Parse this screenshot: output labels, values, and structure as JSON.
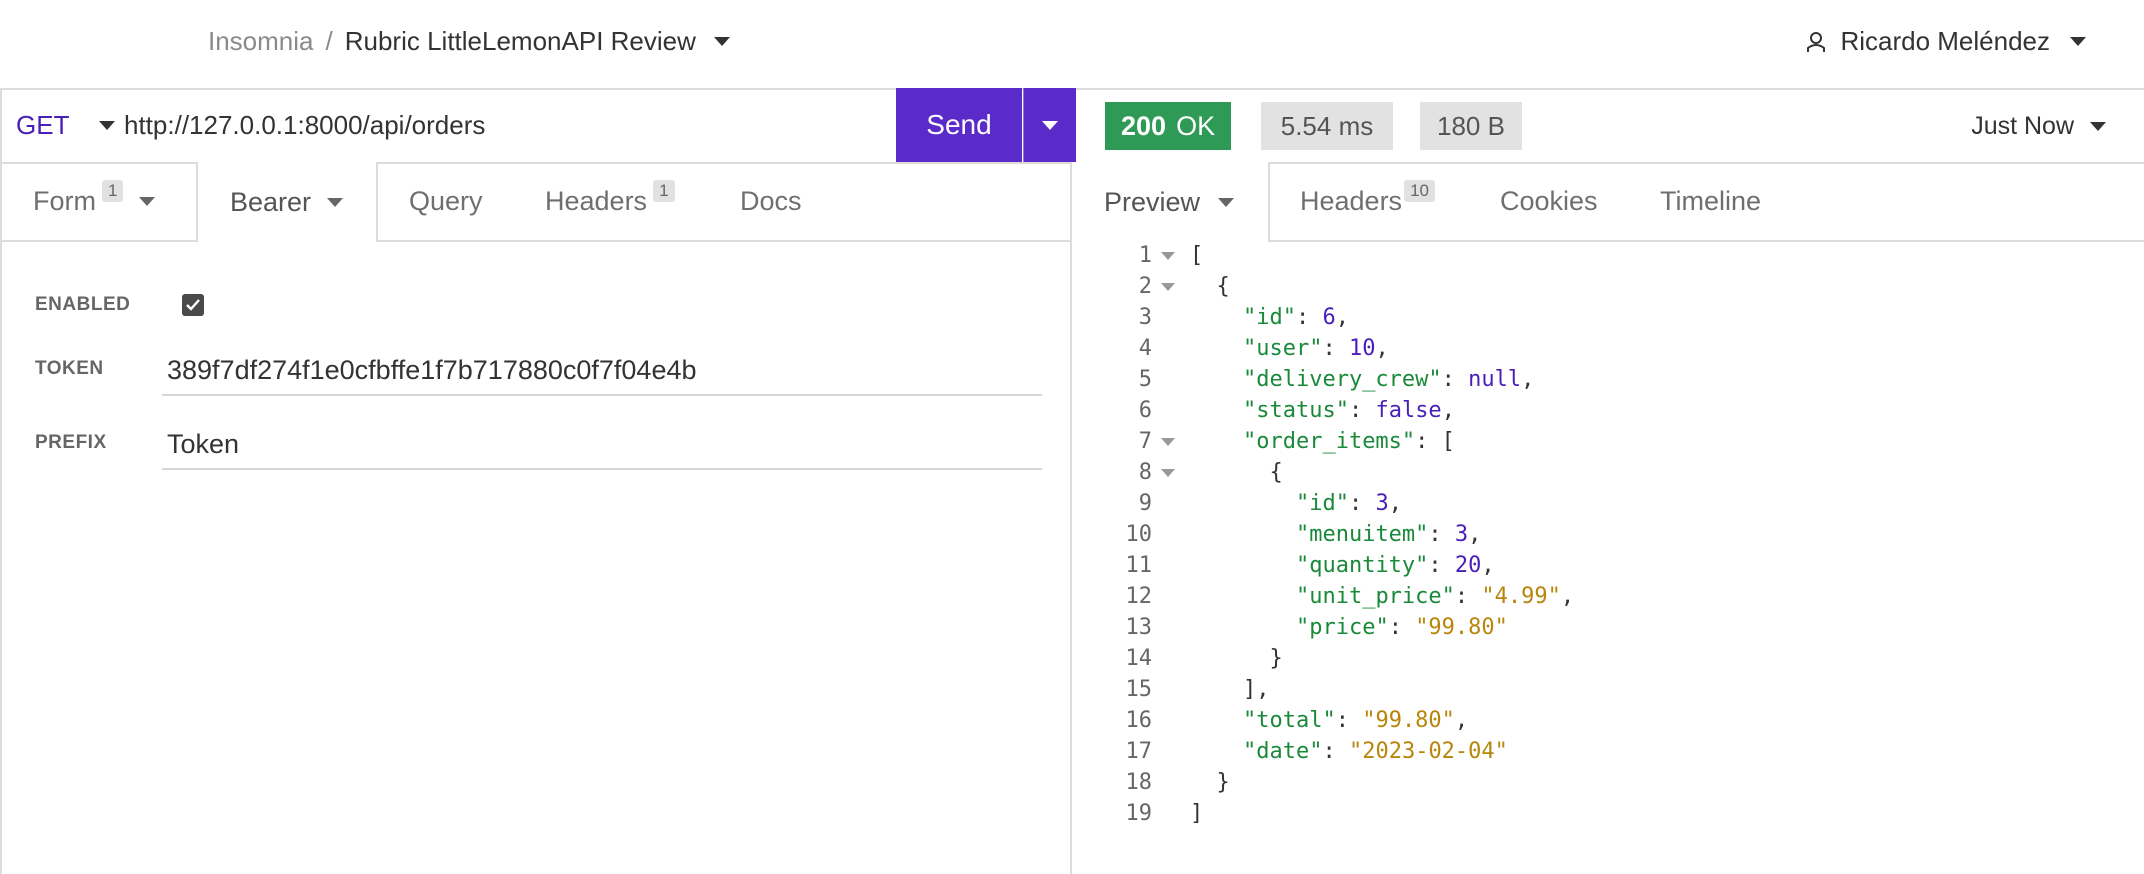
{
  "header": {
    "breadcrumb_home": "Insomnia",
    "breadcrumb_sep": "/",
    "breadcrumb_current": "Rubric LittleLemonAPI Review",
    "user_name": "Ricardo Meléndez"
  },
  "request": {
    "method": "GET",
    "url": "http://127.0.0.1:8000/api/orders",
    "send_label": "Send",
    "tabs": [
      {
        "label": "Form",
        "badge": "1",
        "has_caret": true
      },
      {
        "label": "Bearer",
        "badge": "",
        "has_caret": true,
        "active": true
      },
      {
        "label": "Query",
        "badge": ""
      },
      {
        "label": "Headers",
        "badge": "1"
      },
      {
        "label": "Docs",
        "badge": ""
      }
    ],
    "auth": {
      "enabled_label": "ENABLED",
      "enabled": true,
      "token_label": "TOKEN",
      "token_value": "389f7df274f1e0cfbffe1f7b717880c0f7f04e4b",
      "prefix_label": "PREFIX",
      "prefix_value": "Token"
    }
  },
  "response": {
    "status_code": "200",
    "status_text": "OK",
    "time": "5.54 ms",
    "size": "180 B",
    "when": "Just Now",
    "tabs": [
      {
        "label": "Preview",
        "badge": "",
        "has_caret": true,
        "active": true
      },
      {
        "label": "Headers",
        "badge": "10"
      },
      {
        "label": "Cookies",
        "badge": ""
      },
      {
        "label": "Timeline",
        "badge": ""
      }
    ],
    "body_lines": [
      "[",
      "  {",
      "    \"id\": 6,",
      "    \"user\": 10,",
      "    \"delivery_crew\": null,",
      "    \"status\": false,",
      "    \"order_items\": [",
      "      {",
      "        \"id\": 3,",
      "        \"menuitem\": 3,",
      "        \"quantity\": 20,",
      "        \"unit_price\": \"4.99\",",
      "        \"price\": \"99.80\"",
      "      }",
      "    ],",
      "    \"total\": \"99.80\",",
      "    \"date\": \"2023-02-04\"",
      "  }",
      "]"
    ],
    "foldable_lines": [
      1,
      2,
      7,
      8
    ]
  },
  "colors": {
    "accent_purple": "#5b2bc9",
    "status_green": "#2e9a55",
    "json_key": "#1a8a3a",
    "json_number": "#4a1fb8",
    "json_string": "#b8860b"
  },
  "icons": [
    "chevron-down-icon",
    "user-icon",
    "checkbox-checked-icon",
    "fold-arrow-icon"
  ]
}
